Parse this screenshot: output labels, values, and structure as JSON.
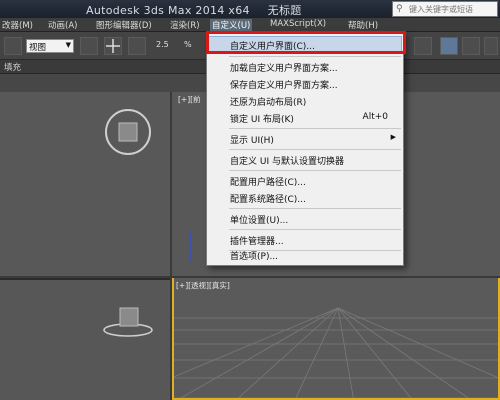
{
  "window": {
    "app_title": "Autodesk 3ds Max  2014 x64",
    "document_title": "无标题",
    "search_placeholder": "键入关键字或短语"
  },
  "menubar": {
    "items": [
      {
        "label": "改器(M)"
      },
      {
        "label": "动画(A)"
      },
      {
        "label": "图形编辑器(D)"
      },
      {
        "label": "渲染(R)"
      },
      {
        "label": "自定义(U)"
      },
      {
        "label": "MAXScript(X)"
      },
      {
        "label": "帮助(H)"
      }
    ],
    "active_index": 4
  },
  "toolbar": {
    "view_select_value": "视图",
    "angle_snap_label": "2.5",
    "percent_label": "%"
  },
  "ribbon": {
    "label": "填充"
  },
  "viewports": {
    "top_label": "[+][前",
    "persp_label": "[+][透视][真实]"
  },
  "dropdown": {
    "items": [
      {
        "label": "自定义用户界面(C)...",
        "shortcut": "",
        "submenu": false
      },
      {
        "label": "加载自定义用户界面方案...",
        "shortcut": "",
        "submenu": false
      },
      {
        "label": "保存自定义用户界面方案...",
        "shortcut": "",
        "submenu": false
      },
      {
        "label": "还原为启动布局(R)",
        "shortcut": "",
        "submenu": false
      },
      {
        "label": "锁定 UI 布局(K)",
        "shortcut": "Alt+0",
        "submenu": false
      },
      {
        "label": "显示 UI(H)",
        "shortcut": "",
        "submenu": true
      },
      {
        "label": "自定义 UI 与默认设置切换器",
        "shortcut": "",
        "submenu": false
      },
      {
        "label": "配置用户路径(C)...",
        "shortcut": "",
        "submenu": false
      },
      {
        "label": "配置系统路径(C)...",
        "shortcut": "",
        "submenu": false
      },
      {
        "label": "单位设置(U)...",
        "shortcut": "",
        "submenu": false
      },
      {
        "label": "插件管理器...",
        "shortcut": "",
        "submenu": false
      },
      {
        "label": "首选项(P)...",
        "shortcut": "",
        "submenu": false
      }
    ],
    "highlighted_index": 0
  },
  "colors": {
    "highlight_box": "#d81818",
    "active_viewport_border": "#e0b020"
  }
}
